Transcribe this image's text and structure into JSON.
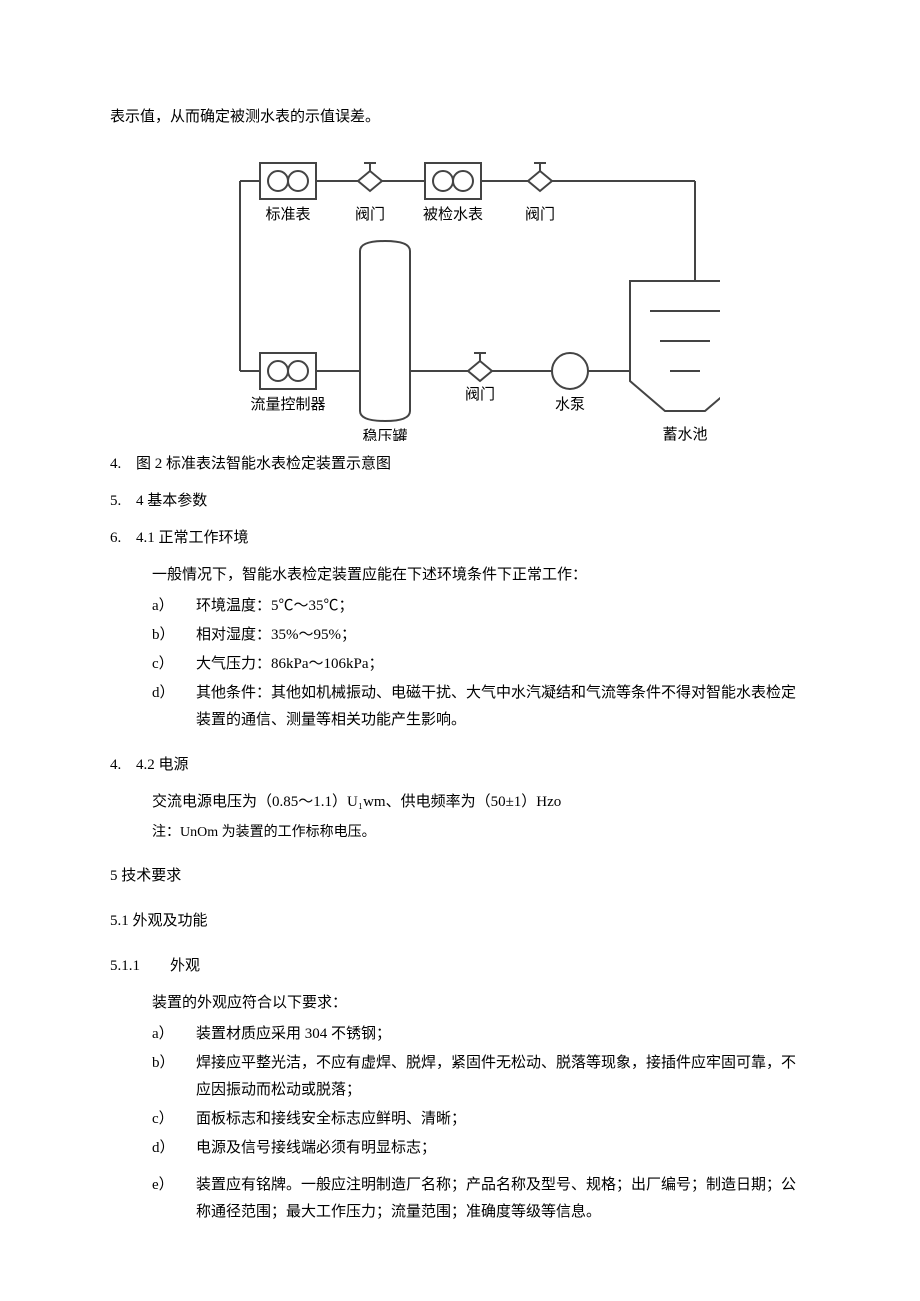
{
  "intro": "表示值，从而确定被测水表的示值误差。",
  "diagram": {
    "std_meter": "标准表",
    "valve": "阀门",
    "tested_meter": "被检水表",
    "flow_controller": "流量控制器",
    "pressure_tank": "稳压罐",
    "pump": "水泵",
    "reservoir": "蓄水池"
  },
  "items": {
    "n4": {
      "num": "4.",
      "text": "图 2 标准表法智能水表检定装置示意图"
    },
    "n5": {
      "num": "5.",
      "text": "4 基本参数"
    },
    "n6": {
      "num": "6.",
      "text": "4.1 正常工作环境"
    }
  },
  "env_intro": "一般情况下，智能水表检定装置应能在下述环境条件下正常工作：",
  "env": {
    "a": {
      "m": "a）",
      "t": "环境温度：5℃～35℃；"
    },
    "b": {
      "m": "b）",
      "t": "相对湿度：35%～95%；"
    },
    "c": {
      "m": "c）",
      "t": "大气压力：86kPa～106kPa；"
    },
    "d": {
      "m": "d）",
      "t": "其他条件：其他如机械振动、电磁干扰、大气中水汽凝结和气流等条件不得对智能水表检定装置的通信、测量等相关功能产生影响。"
    }
  },
  "power_heading": {
    "num": "4.",
    "text": "4.2 电源"
  },
  "power_line": "交流电源电压为（0.85～1.1）U₁ᴡm、供电频率为（50±1）Hzo",
  "power_note": "注：UnOm 为装置的工作标称电压。",
  "tech_req_heading": "5 技术要求",
  "appearance_heading": "5.1 外观及功能",
  "appearance_sub_heading": "5.1.1　　外观",
  "appearance_intro": "装置的外观应符合以下要求：",
  "appearance": {
    "a": {
      "m": "a）",
      "t": "装置材质应采用 304 不锈钢；"
    },
    "b": {
      "m": "b）",
      "t": "焊接应平整光洁，不应有虚焊、脱焊，紧固件无松动、脱落等现象，接插件应牢固可靠，不应因振动而松动或脱落；"
    },
    "c": {
      "m": "c）",
      "t": "面板标志和接线安全标志应鲜明、清晰；"
    },
    "d": {
      "m": "d）",
      "t": "电源及信号接线端必须有明显标志；"
    },
    "e": {
      "m": "e）",
      "t": "装置应有铭牌。一般应注明制造厂名称；产品名称及型号、规格；出厂编号；制造日期；公称通径范围；最大工作压力；流量范围；准确度等级等信息。"
    }
  }
}
